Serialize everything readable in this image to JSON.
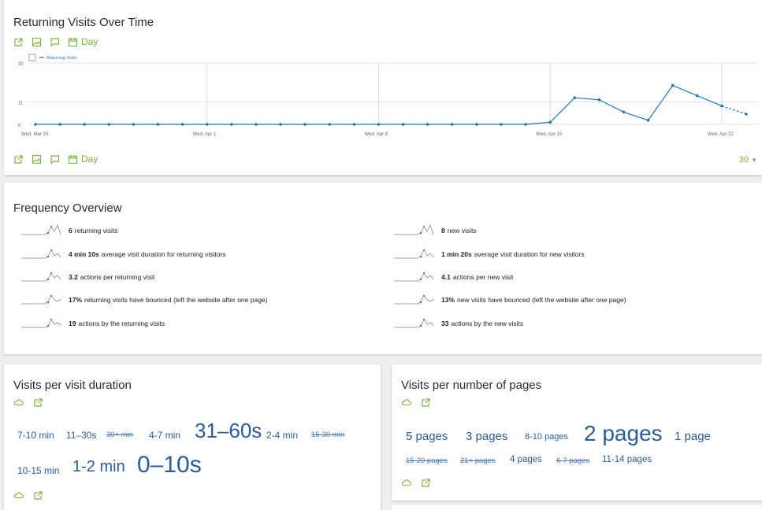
{
  "evolution": {
    "title": "Returning Visits Over Time",
    "period_label": "Day",
    "limit_value": "30",
    "chart_data": {
      "type": "line",
      "series": [
        {
          "name": "Returning Visits",
          "x": [
            "Mar 25",
            "Mar 26",
            "Mar 27",
            "Mar 28",
            "Mar 29",
            "Mar 30",
            "Mar 31",
            "Apr 1",
            "Apr 2",
            "Apr 3",
            "Apr 4",
            "Apr 5",
            "Apr 6",
            "Apr 7",
            "Apr 8",
            "Apr 9",
            "Apr 10",
            "Apr 11",
            "Apr 12",
            "Apr 13",
            "Apr 14",
            "Apr 15",
            "Apr 16",
            "Apr 17",
            "Apr 18",
            "Apr 19",
            "Apr 20",
            "Apr 21",
            "Apr 22",
            "Apr 23"
          ],
          "values": [
            0,
            0,
            0,
            0,
            0,
            0,
            0,
            0,
            0,
            0,
            0,
            0,
            0,
            0,
            0,
            0,
            0,
            0,
            0,
            0,
            0,
            1,
            13,
            12,
            6,
            2,
            19,
            14,
            9,
            5
          ],
          "color": "#1f78b4"
        }
      ],
      "ylim": [
        0,
        30
      ],
      "y_ticks": [
        "0",
        "11",
        "30"
      ],
      "x_tick_labels": [
        "Wed, Mar 25",
        "Wed, Apr 1",
        "Wed, Apr 8",
        "Wed, Apr 15",
        "Wed, Apr 22"
      ],
      "legend_position": "top-left",
      "last_segment_dashed": true
    }
  },
  "overview": {
    "title": "Frequency Overview",
    "returning": [
      {
        "bold": "6",
        "text": "returning visits"
      },
      {
        "bold": "4 min 10s",
        "text": "average visit duration for returning visitors"
      },
      {
        "bold": "3.2",
        "text": "actions per returning visit"
      },
      {
        "bold": "17%",
        "text": "returning visits have bounced (left the website after one page)"
      },
      {
        "bold": "19",
        "text": "actions by the returning visits"
      }
    ],
    "new": [
      {
        "bold": "8",
        "text": "new visits"
      },
      {
        "bold": "1 min 20s",
        "text": "average visit duration for new visitors"
      },
      {
        "bold": "4.1",
        "text": "actions per new visit"
      },
      {
        "bold": "13%",
        "text": "new visits have bounced (left the website after one page)"
      },
      {
        "bold": "33",
        "text": "actions by the new visits"
      }
    ]
  },
  "duration": {
    "title": "Visits per visit duration",
    "tags": [
      "7-10 min",
      "11–30s",
      "30+ min",
      "4-7 min",
      "31–60s",
      "2-4 min",
      "15-30 min",
      "10-15 min",
      "1-2 min",
      "0–10s"
    ]
  },
  "pages": {
    "title": "Visits per number of pages",
    "tags": [
      "5 pages",
      "3 pages",
      "8-10 pages",
      "2 pages",
      "1 page",
      "15-20 pages",
      "21+ pages",
      "4 pages",
      "6-7 pages",
      "11-14 pages"
    ]
  },
  "colors": {
    "accent_green": "#7cb342",
    "tag_blue": "#2c5c94",
    "line_blue": "#1f78b4",
    "spark_red": "#e53935"
  }
}
